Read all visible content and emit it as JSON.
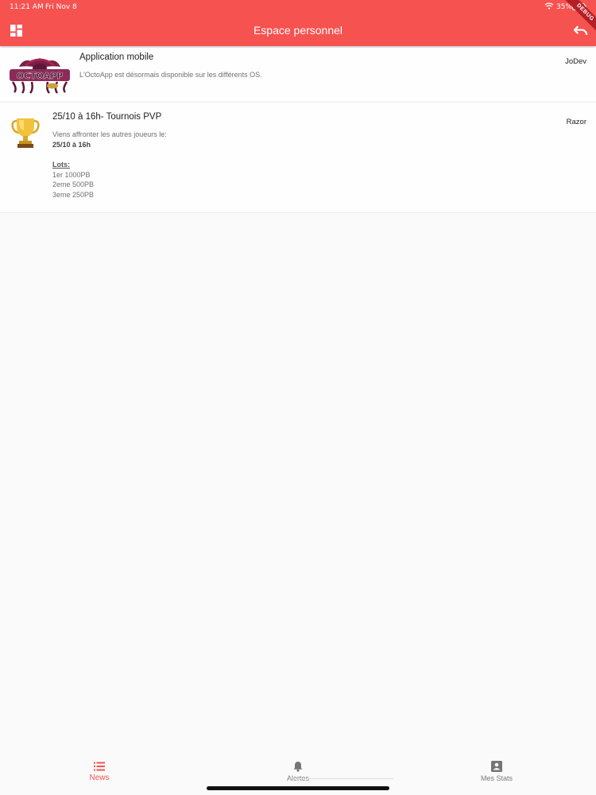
{
  "status_bar": {
    "time": "11:21 AM",
    "date": "Fri Nov 8",
    "battery": "35%",
    "icons": [
      "wifi-icon",
      "battery-icon"
    ]
  },
  "app_bar": {
    "title": "Espace personnel",
    "left_icon": "dashboard-icon",
    "right_icon": "undo-icon",
    "color": "#f65250"
  },
  "debug_banner": "DEBUG",
  "news": [
    {
      "title": "Application mobile",
      "author": "JoDev",
      "body": "L'OctoApp est désormais disponible sur les différents OS.",
      "logo_text": "OCTOAPP"
    },
    {
      "title": "25/10 à 16h- Tournois PVP",
      "author": "Razor",
      "intro": "Viens affronter les autres joueurs le:",
      "datetime": "25/10 à 16h",
      "lots_label": "Lots:",
      "lots": [
        "1er 1000PB",
        "2eme 500PB",
        "3eme 250PB"
      ],
      "icon": "trophy-icon"
    }
  ],
  "bottom_nav": {
    "items": [
      {
        "label": "News",
        "icon": "list-icon",
        "active": true
      },
      {
        "label": "Alertes",
        "icon": "bell-icon",
        "active": false
      },
      {
        "label": "Mes Stats",
        "icon": "contact-card-icon",
        "active": false
      }
    ],
    "active_color": "#f65250",
    "inactive_color": "#7a7a7a"
  }
}
